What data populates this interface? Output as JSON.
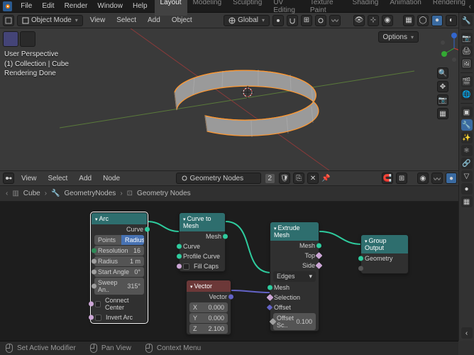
{
  "top_menu": {
    "items": [
      "File",
      "Edit",
      "Render",
      "Window",
      "Help"
    ],
    "workspaces": [
      "Layout",
      "Modeling",
      "Sculpting",
      "UV Editing",
      "Texture Paint",
      "Shading",
      "Animation",
      "Rendering"
    ],
    "active_workspace": "Layout"
  },
  "viewport": {
    "mode": "Object Mode",
    "menu": [
      "View",
      "Select",
      "Add",
      "Object"
    ],
    "orientation": "Global",
    "options_label": "Options",
    "info_line1": "User Perspective",
    "info_line2": "(1) Collection | Cube",
    "info_line3": "Rendering Done"
  },
  "node_editor": {
    "menu": [
      "View",
      "Select",
      "Add",
      "Node"
    ],
    "type_label": "Geometry Nodes",
    "count": "2",
    "breadcrumb": {
      "object": "Cube",
      "modifier": "GeometryNodes",
      "group": "Geometry Nodes"
    }
  },
  "nodes": {
    "arc": {
      "title": "Arc",
      "out_curve": "Curve",
      "mode_points": "Points",
      "mode_radius": "Radius",
      "resolution_label": "Resolution",
      "resolution_value": "16",
      "radius_label": "Radius",
      "radius_value": "1 m",
      "start_angle_label": "Start Angle",
      "start_angle_value": "0°",
      "sweep_label": "Sweep An..",
      "sweep_value": "315°",
      "connect_center": "Connect Center",
      "invert_arc": "Invert Arc"
    },
    "curve_to_mesh": {
      "title": "Curve to Mesh",
      "out_mesh": "Mesh",
      "in_curve": "Curve",
      "in_profile": "Profile Curve",
      "fill_caps": "Fill Caps"
    },
    "vector": {
      "title": "Vector",
      "out_vector": "Vector",
      "x_label": "X",
      "x_value": "0.000",
      "y_label": "Y",
      "y_value": "0.000",
      "z_label": "Z",
      "z_value": "2.100"
    },
    "extrude": {
      "title": "Extrude Mesh",
      "out_mesh": "Mesh",
      "out_top": "Top",
      "out_side": "Side",
      "mode": "Edges",
      "in_mesh": "Mesh",
      "in_selection": "Selection",
      "in_offset": "Offset",
      "offset_scale_label": "Offset Sc..",
      "offset_scale_value": "0.100"
    },
    "group_output": {
      "title": "Group Output",
      "in_geometry": "Geometry"
    }
  },
  "statusbar": {
    "set_active": "Set Active Modifier",
    "pan_view": "Pan View",
    "context_menu": "Context Menu"
  }
}
